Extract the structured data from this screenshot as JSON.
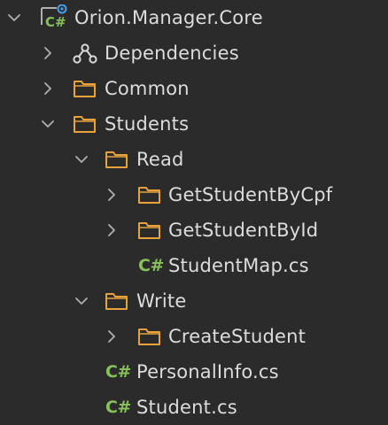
{
  "tree": {
    "project": {
      "label": "Orion.Manager.Core",
      "icon": "csharp-project-icon",
      "icon_text": "C#",
      "expanded": true
    },
    "dependencies": {
      "label": "Dependencies",
      "icon": "dependencies-icon",
      "expanded": false
    },
    "common": {
      "label": "Common",
      "icon": "folder-icon",
      "expanded": false
    },
    "students": {
      "label": "Students",
      "icon": "folder-icon",
      "expanded": true,
      "read": {
        "label": "Read",
        "icon": "folder-icon",
        "expanded": true,
        "get_by_cpf": {
          "label": "GetStudentByCpf",
          "icon": "folder-icon",
          "expanded": false
        },
        "get_by_id": {
          "label": "GetStudentById",
          "icon": "folder-icon",
          "expanded": false
        },
        "student_map": {
          "label": "StudentMap.cs",
          "icon": "csharp-file-icon",
          "icon_text": "C#"
        }
      },
      "write": {
        "label": "Write",
        "icon": "folder-icon",
        "expanded": true,
        "create_student": {
          "label": "CreateStudent",
          "icon": "folder-icon",
          "expanded": false
        }
      },
      "personal_info": {
        "label": "PersonalInfo.cs",
        "icon": "csharp-file-icon",
        "icon_text": "C#"
      },
      "student": {
        "label": "Student.cs",
        "icon": "csharp-file-icon",
        "icon_text": "C#"
      }
    }
  },
  "colors": {
    "background": "#2b2b2b",
    "text": "#dcdcdc",
    "folder_stroke": "#e8a23c",
    "csharp_green": "#87c05a",
    "project_badge": "#4aa0e8",
    "arrow": "#b0b0b0"
  }
}
